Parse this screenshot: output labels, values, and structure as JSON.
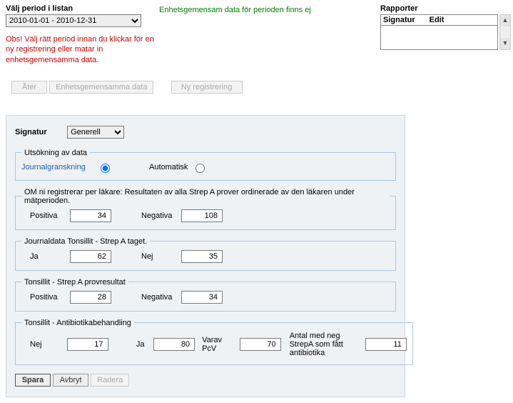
{
  "top": {
    "period_label": "Välj period i listan",
    "period_value": "2010-01-01 - 2010-12-31",
    "mid_msg": "Enhetsgemensam data för perioden finns ej",
    "rapport_label": "Rapporter",
    "rapport_cols": {
      "c1": "Signatur",
      "c2": "Edit"
    },
    "warning": "Obs! Välj rätt period innan du klickar för en ny registrering eller matar in enhetsgemensamma data."
  },
  "buttons": {
    "ater": "Åter",
    "enhets": "Enhetsgemensamma data",
    "nyreg": "Ny registrering",
    "spara": "Spara",
    "avbryt": "Avbryt",
    "radera": "Radera"
  },
  "panel": {
    "sig_label": "Signatur",
    "sig_value": "Generell",
    "utsokning": {
      "legend": "Utsökning av data",
      "journal": "Journalgranskning",
      "auto": "Automatisk"
    },
    "om": {
      "legend": "OM ni registrerar per läkare: Resultaten av alla Strep A prover ordinerade av den läkaren under mätperioden.",
      "pos_label": "Positiva",
      "pos_val": "34",
      "neg_label": "Negativa",
      "neg_val": "108"
    },
    "journaldata": {
      "legend": "Journaldata Tonsillit - Strep A taget.",
      "ja_label": "Ja",
      "ja_val": "62",
      "nej_label": "Nej",
      "nej_val": "35"
    },
    "provresultat": {
      "legend": "Tonsillit - Strep A   provresultat",
      "pos_label": "Positiva",
      "pos_val": "28",
      "neg_label": "Negativa",
      "neg_val": "34"
    },
    "antibiotika": {
      "legend": "Tonsillit -   Antibiotikabehandling",
      "nej_label": "Nej",
      "nej_val": "17",
      "ja_label": "Ja",
      "ja_val": "80",
      "varav_label": "Varav PcV",
      "varav_val": "70",
      "antal_label": "Antal med neg StrepA som fått antibiotika",
      "antal_val": "11"
    }
  }
}
